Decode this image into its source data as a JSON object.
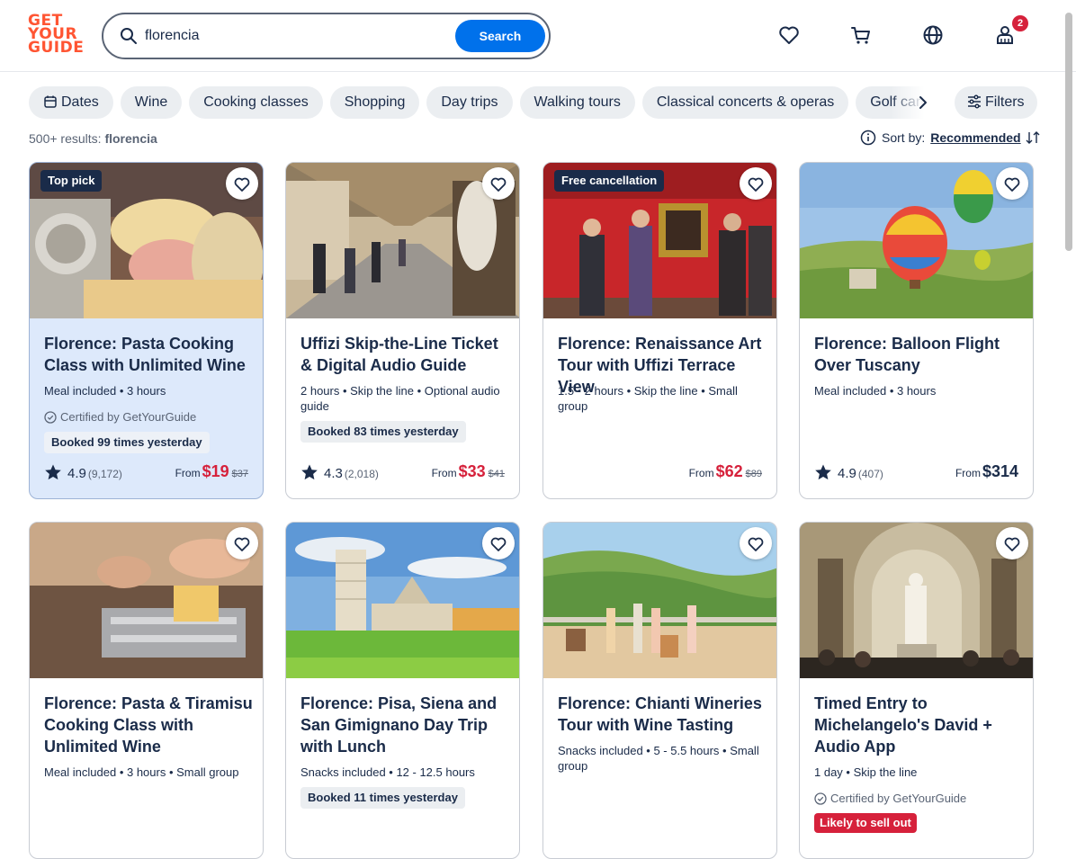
{
  "header": {
    "logo_lines": [
      "GET",
      "YOUR",
      "GUIDE"
    ],
    "search_value": "florencia",
    "search_button": "Search",
    "icons": [
      "heart-icon",
      "cart-icon",
      "globe-icon",
      "profile-icon"
    ],
    "notification_count": "2"
  },
  "chips": {
    "items": [
      "Dates",
      "Wine",
      "Cooking classes",
      "Shopping",
      "Day trips",
      "Walking tours",
      "Classical concerts & operas",
      "Golf carts"
    ],
    "filters": "Filters"
  },
  "results": {
    "count": "500+ results:",
    "query": "florencia"
  },
  "sort": {
    "label": "Sort by:",
    "value": "Recommended"
  },
  "cards": [
    {
      "tag": "Top pick",
      "title": "Florence: Pasta Cooking Class with Unlimited Wine",
      "meta": "Meal included • 3 hours",
      "certified": "Certified by GetYourGuide",
      "booked": "Booked 99 times yesterday",
      "rating": "4.9",
      "reviews": "(9,172)",
      "price_from": "From",
      "price": "$19",
      "old_price": "$37"
    },
    {
      "title": "Uffizi Skip-the-Line Ticket & Digital Audio Guide",
      "meta": "2 hours • Skip the line • Optional audio guide",
      "booked": "Booked 83 times yesterday",
      "rating": "4.3",
      "reviews": "(2,018)",
      "price_from": "From",
      "price": "$33",
      "old_price": "$41"
    },
    {
      "tag": "Free cancellation",
      "title": "Florence: Renaissance Art Tour with Uffizi Terrace View",
      "meta": "1.5 - 2 hours • Skip the line • Small group",
      "price_from": "From",
      "price": "$62",
      "old_price": "$89"
    },
    {
      "title": "Florence: Balloon Flight Over Tuscany",
      "meta": "Meal included • 3 hours",
      "rating": "4.9",
      "reviews": "(407)",
      "price_from": "From",
      "price": "$314"
    },
    {
      "title": "Florence: Pasta & Tiramisu Cooking Class with Unlimited Wine",
      "meta": "Meal included • 3 hours • Small group"
    },
    {
      "title": "Florence: Pisa, Siena and San Gimignano Day Trip with Lunch",
      "meta": "Snacks included • 12 - 12.5 hours",
      "booked": "Booked 11 times yesterday"
    },
    {
      "title": "Florence: Chianti Wineries Tour with Wine Tasting",
      "meta": "Snacks included • 5 - 5.5 hours • Small group"
    },
    {
      "title": "Timed Entry to Michelangelo's David + Audio App",
      "meta": "1 day • Skip the line",
      "certified": "Certified by GetYourGuide",
      "sellout": "Likely to sell out"
    }
  ],
  "colors": {
    "brand": "#ff5533",
    "accent": "#0071eb",
    "price_red": "#d6213b",
    "text": "#1a2b49"
  }
}
